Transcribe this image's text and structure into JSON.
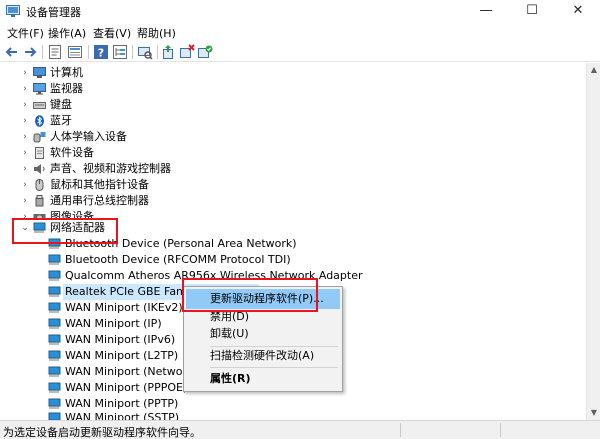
{
  "window": {
    "title": "设备管理器",
    "controls": {
      "minimize": "—",
      "maximize": "☐",
      "close": "✕"
    }
  },
  "menubar": {
    "file": "文件(F)",
    "action": "操作(A)",
    "view": "查看(V)",
    "help": "帮助(H)"
  },
  "toolbar": {
    "buttons": [
      "back-icon",
      "forward-icon",
      "properties-sheet-icon",
      "list-icon",
      "help-icon",
      "tree-view-icon",
      "scan-icon",
      "update-driver-icon",
      "uninstall-icon",
      "enable-device-icon"
    ]
  },
  "tree": {
    "categories": [
      {
        "label": "计算机",
        "icon": "computer-icon"
      },
      {
        "label": "监视器",
        "icon": "monitor-icon"
      },
      {
        "label": "键盘",
        "icon": "keyboard-icon"
      },
      {
        "label": "蓝牙",
        "icon": "bluetooth-icon"
      },
      {
        "label": "人体学输入设备",
        "icon": "hid-icon"
      },
      {
        "label": "软件设备",
        "icon": "software-device-icon"
      },
      {
        "label": "声音、视频和游戏控制器",
        "icon": "speaker-icon"
      },
      {
        "label": "鼠标和其他指针设备",
        "icon": "mouse-icon"
      },
      {
        "label": "通用串行总线控制器",
        "icon": "usb-icon"
      },
      {
        "label": "图像设备",
        "icon": "camera-icon"
      }
    ],
    "expanded_category": {
      "label": "网络适配器",
      "icon": "network-adapter-icon"
    },
    "adapters": [
      "Bluetooth Device (Personal Area Network)",
      "Bluetooth Device (RFCOMM Protocol TDI)",
      "Qualcomm Atheros AR956x Wireless Network Adapter",
      "Realtek PCIe GBE Family Controller",
      "WAN Miniport (IKEv2)",
      "WAN Miniport (IP)",
      "WAN Miniport (IPv6)",
      "WAN Miniport (L2TP)",
      "WAN Miniport (Network M",
      "WAN Miniport (PPPOE)",
      "WAN Miniport (PPTP)",
      "WAN Miniport (SSTP)"
    ]
  },
  "context_menu": {
    "update_driver": "更新驱动程序软件(P)...",
    "disable": "禁用(D)",
    "uninstall": "卸载(U)",
    "scan": "扫描检测硬件改动(A)",
    "properties": "属性(R)"
  },
  "statusbar": {
    "text": "为选定设备启动更新驱动程序软件向导。"
  },
  "colors": {
    "highlight": "#91c9f7",
    "selection": "#cce8ff",
    "annotation_red": "#e8141e",
    "adapter_blue": "#2b8fd6"
  }
}
